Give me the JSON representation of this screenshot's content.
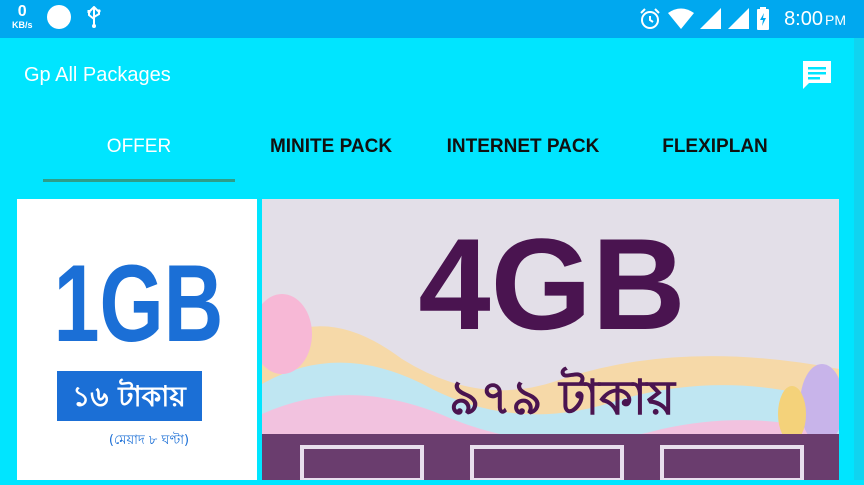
{
  "status_bar": {
    "net_speed_value": "0",
    "net_speed_unit": "KB/s",
    "time": "8:00",
    "ampm": "PM",
    "icons": [
      "circle-icon",
      "usb-icon",
      "alarm-icon",
      "wifi-icon",
      "signal-icon",
      "signal-icon",
      "battery-charging-icon"
    ]
  },
  "app_bar": {
    "title": "Gp All Packages",
    "action_icon": "message-icon"
  },
  "tabs": [
    {
      "label": "OFFER",
      "active": true
    },
    {
      "label": "MINITE PACK",
      "active": false
    },
    {
      "label": "INTERNET PACK",
      "active": false
    },
    {
      "label": "FLEXIPLAN",
      "active": false
    }
  ],
  "offers": [
    {
      "big": "1GB",
      "price": "১৬ টাকায়",
      "note": "(মেয়াদ ৮ ঘণ্টা)"
    },
    {
      "big": "4GB",
      "price": "৯৭৯ টাকায়"
    }
  ],
  "colors": {
    "status_bar": "#00a8ef",
    "app_bg": "#00e5ff",
    "tab_indicator": "#2e9e8a",
    "offer1_blue": "#1b6fd6",
    "offer2_purple": "#4a1450"
  }
}
